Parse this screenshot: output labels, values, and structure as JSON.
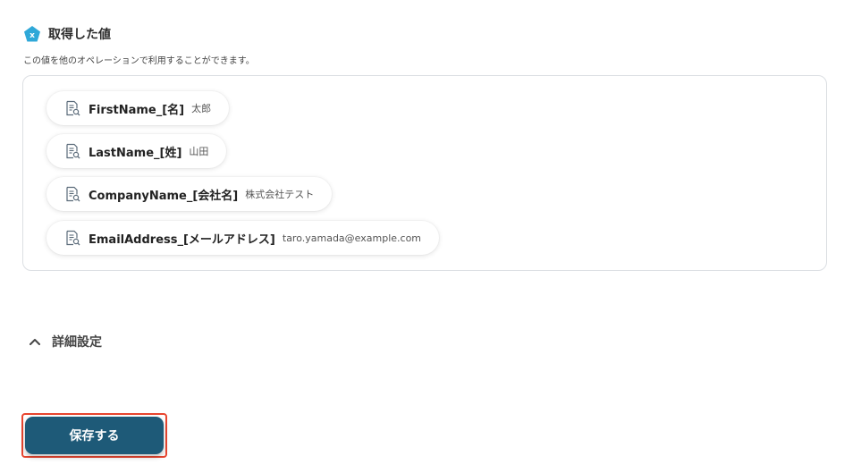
{
  "output_section": {
    "icon_letter": "x",
    "title": "取得した値",
    "description": "この値を他のオペレーションで利用することができます。"
  },
  "fields": [
    {
      "key": "FirstName_[名]",
      "value": "太郎"
    },
    {
      "key": "LastName_[姓]",
      "value": "山田"
    },
    {
      "key": "CompanyName_[会社名]",
      "value": "株式会社テスト"
    },
    {
      "key": "EmailAddress_[メールアドレス]",
      "value": "taro.yamada@example.com"
    }
  ],
  "advanced": {
    "label": "詳細設定"
  },
  "actions": {
    "save_label": "保存する"
  },
  "colors": {
    "accent": "#2fa8d8",
    "primary_button": "#1e5a78",
    "highlight_border": "#e8452f"
  }
}
